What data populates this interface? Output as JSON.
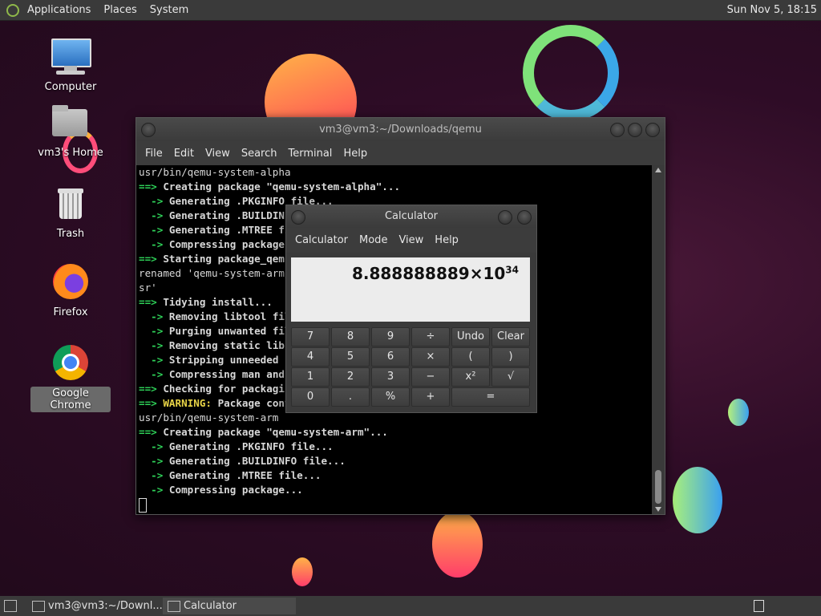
{
  "top_panel": {
    "menus": [
      "Applications",
      "Places",
      "System"
    ],
    "clock": "Sun Nov 5, 18:15"
  },
  "desktop_icons": [
    "Computer",
    "vm3's Home",
    "Trash",
    "Firefox",
    "Google Chrome"
  ],
  "terminal": {
    "title": "vm3@vm3:~/Downloads/qemu",
    "menus": [
      "File",
      "Edit",
      "View",
      "Search",
      "Terminal",
      "Help"
    ],
    "lines": [
      {
        "prefix": "",
        "text": "usr/bin/qemu-system-alpha",
        "plain": true
      },
      {
        "prefix": "==>",
        "text": " Creating package \"qemu-system-alpha\"..."
      },
      {
        "prefix": "  ->",
        "text": " Generating .PKGINFO file..."
      },
      {
        "prefix": "  ->",
        "text": " Generating .BUILDINFO file..."
      },
      {
        "prefix": "  ->",
        "text": " Generating .MTREE file..."
      },
      {
        "prefix": "  ->",
        "text": " Compressing package..."
      },
      {
        "prefix": "==>",
        "text": " Starting package_qemu-system-arm()..."
      },
      {
        "prefix": "",
        "text": "renamed 'qemu-system-arm/usr' -> '/qemu-system-arm/u",
        "plain": true
      },
      {
        "prefix": "",
        "text": "sr'",
        "plain": true
      },
      {
        "prefix": "==>",
        "text": " Tidying install..."
      },
      {
        "prefix": "  ->",
        "text": " Removing libtool files..."
      },
      {
        "prefix": "  ->",
        "text": " Purging unwanted files..."
      },
      {
        "prefix": "  ->",
        "text": " Removing static library files..."
      },
      {
        "prefix": "  ->",
        "text": " Stripping unneeded symbols..."
      },
      {
        "prefix": "  ->",
        "text": " Compressing man and info pages..."
      },
      {
        "prefix": "==>",
        "text": " Checking for packaging issues..."
      },
      {
        "prefix": "==>",
        "text": " Package contains reference to $srcdir",
        "warning": "WARNING:"
      },
      {
        "prefix": "",
        "text": "usr/bin/qemu-system-arm",
        "plain": true
      },
      {
        "prefix": "==>",
        "text": " Creating package \"qemu-system-arm\"..."
      },
      {
        "prefix": "  ->",
        "text": " Generating .PKGINFO file..."
      },
      {
        "prefix": "  ->",
        "text": " Generating .BUILDINFO file..."
      },
      {
        "prefix": "  ->",
        "text": " Generating .MTREE file..."
      },
      {
        "prefix": "  ->",
        "text": " Compressing package..."
      }
    ]
  },
  "calculator": {
    "title": "Calculator",
    "menus": [
      "Calculator",
      "Mode",
      "View",
      "Help"
    ],
    "display_mantissa": "8.888888889×10",
    "display_exponent": "34",
    "keys": [
      [
        "7",
        "8",
        "9",
        "÷",
        "Undo",
        "Clear"
      ],
      [
        "4",
        "5",
        "6",
        "×",
        "(",
        ")"
      ],
      [
        "1",
        "2",
        "3",
        "−",
        "x²",
        "√"
      ],
      [
        "0",
        ".",
        "%",
        "+",
        "="
      ]
    ]
  },
  "taskbar": {
    "tasks": [
      "vm3@vm3:~/Downl...",
      "Calculator"
    ]
  },
  "colors": {
    "panel": "#3a3a3a",
    "terminal_bg": "#000000",
    "prompt_green": "#2ed158",
    "warning_yellow": "#e8d447"
  }
}
